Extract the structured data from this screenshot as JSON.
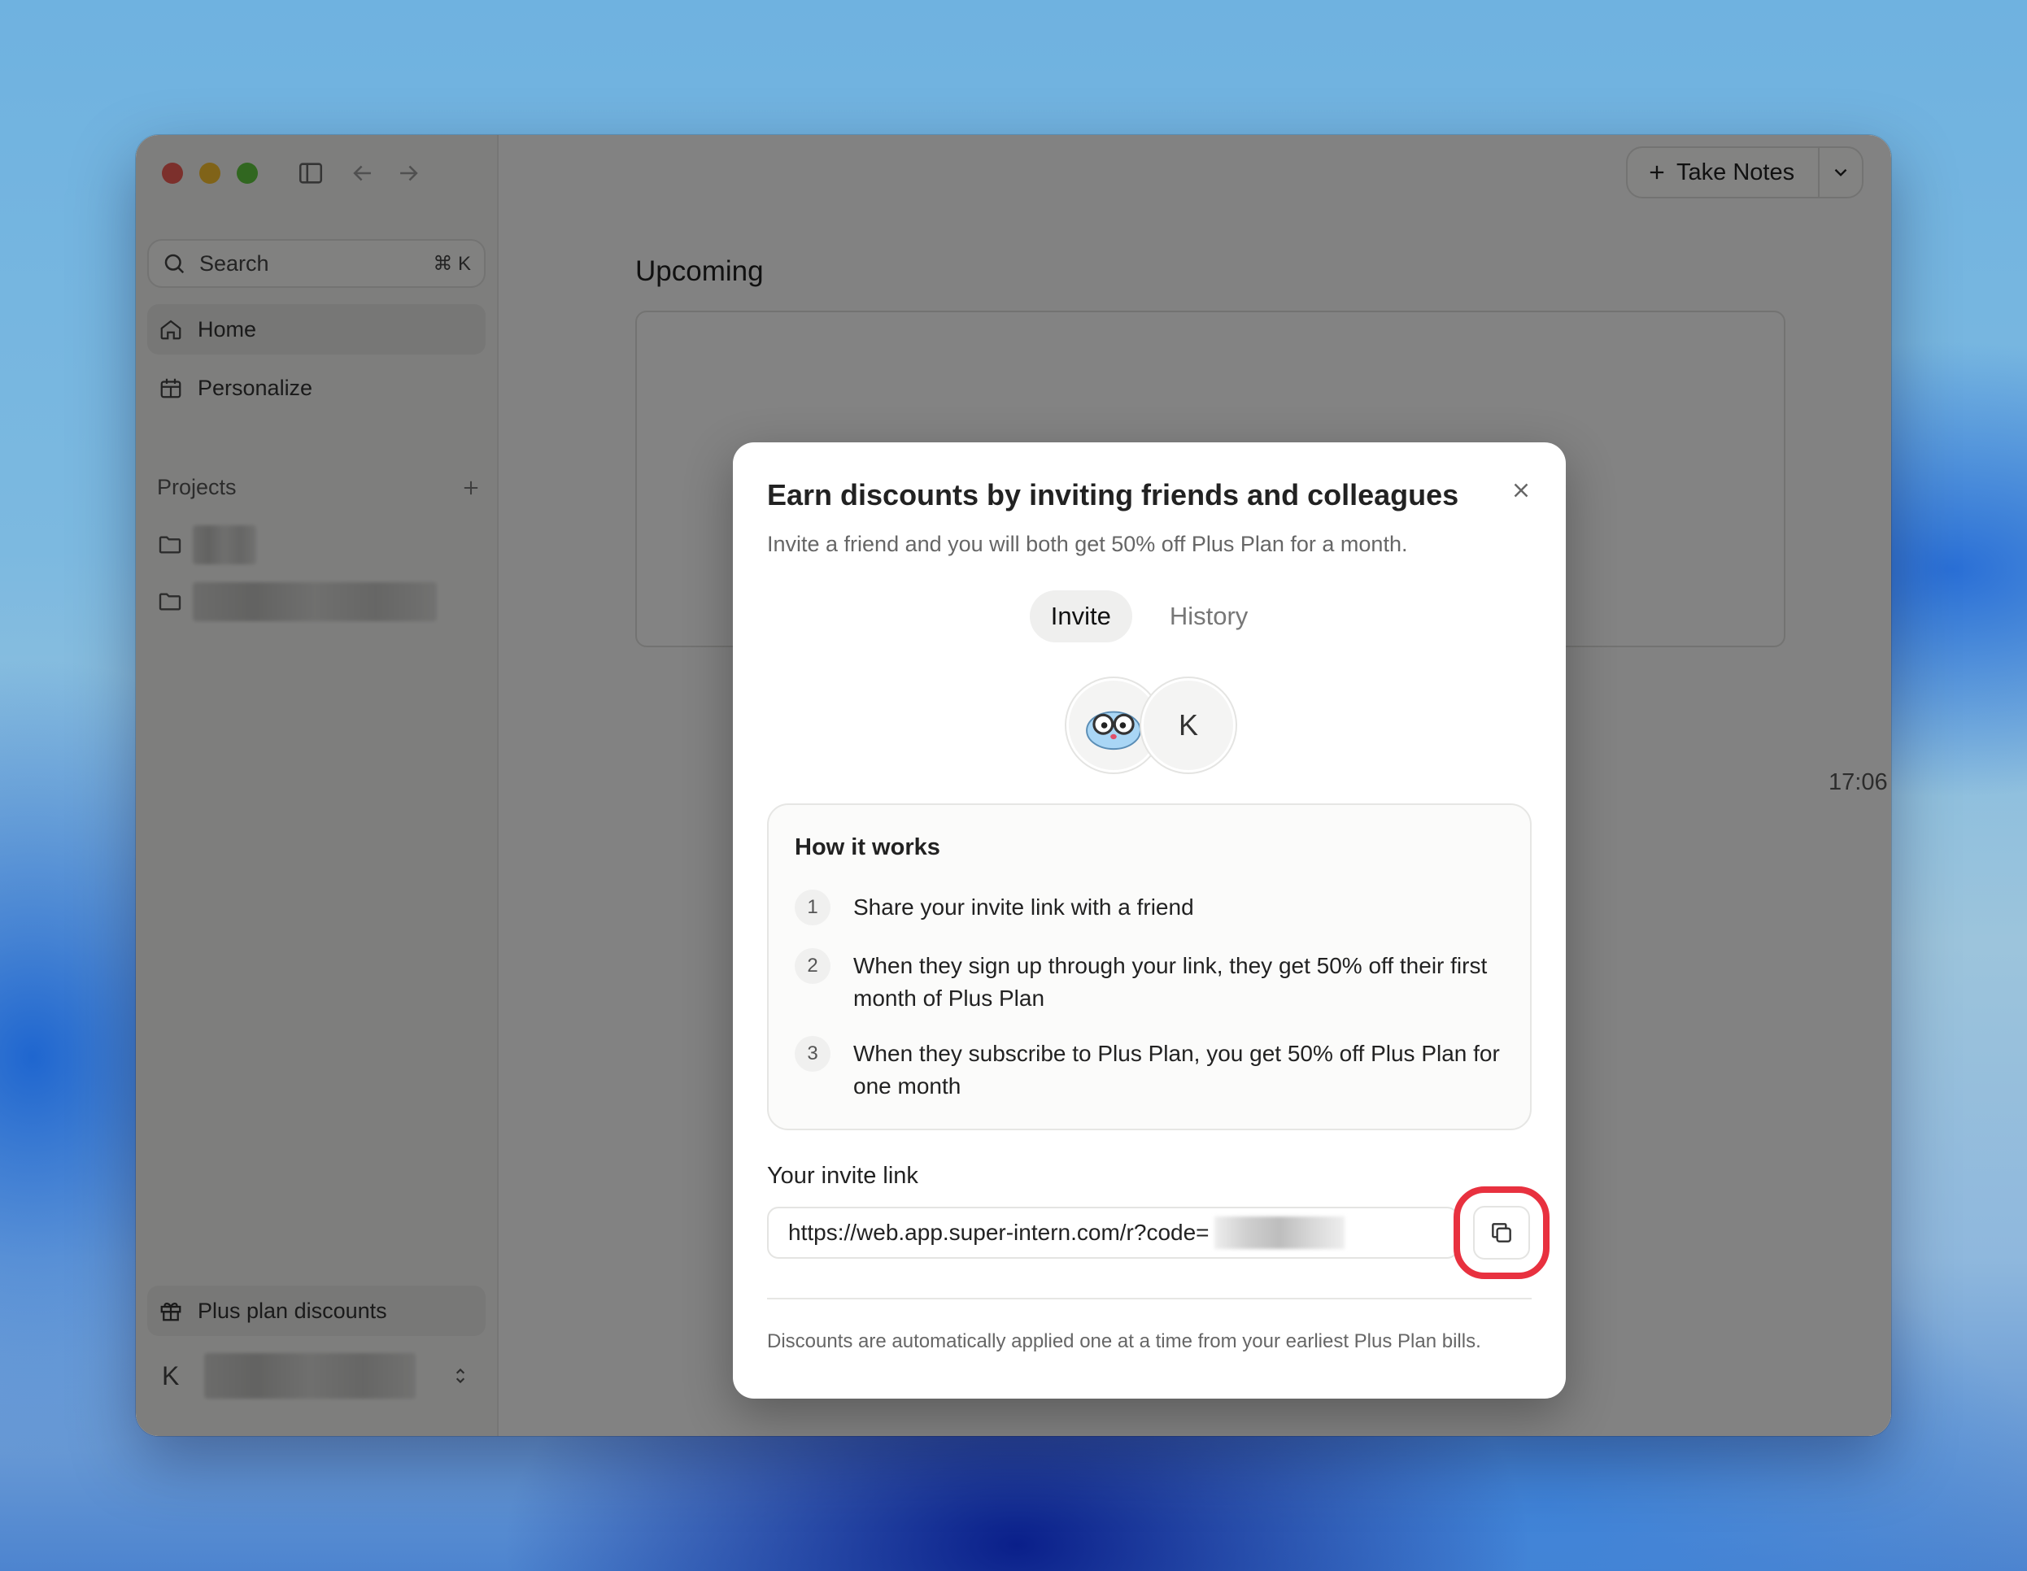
{
  "sidebar": {
    "search": {
      "label": "Search",
      "shortcut": "⌘ K"
    },
    "nav": [
      {
        "label": "Home",
        "icon": "home-icon"
      },
      {
        "label": "Personalize",
        "icon": "gift-calendar-icon"
      }
    ],
    "projects_title": "Projects",
    "plus_plan_label": "Plus plan discounts",
    "user_initial": "K"
  },
  "header": {
    "take_notes_label": "Take Notes"
  },
  "main": {
    "section_title": "Upcoming",
    "time": "17:06"
  },
  "modal": {
    "title": "Earn discounts by inviting friends and colleagues",
    "subtitle": "Invite a friend and you will both get 50% off Plus Plan for a month.",
    "tabs": [
      {
        "label": "Invite",
        "active": true
      },
      {
        "label": "History",
        "active": false
      }
    ],
    "avatar_letter": "K",
    "how_title": "How it works",
    "steps": [
      {
        "num": "1",
        "text": "Share your invite link with a friend"
      },
      {
        "num": "2",
        "text": "When they sign up through your link, they get 50% off their first month of Plus Plan"
      },
      {
        "num": "3",
        "text": "When they subscribe to Plus Plan, you get 50% off Plus Plan for one month"
      }
    ],
    "link_label": "Your invite link",
    "link_value": "https://web.app.super-intern.com/r?code=",
    "footnote": "Discounts are automatically applied one at a time from your earliest Plus Plan bills."
  },
  "colors": {
    "highlight": "#e8313f",
    "traffic_red": "#ee5c55",
    "traffic_yellow": "#f5bf2f",
    "traffic_green": "#5fc63f"
  }
}
